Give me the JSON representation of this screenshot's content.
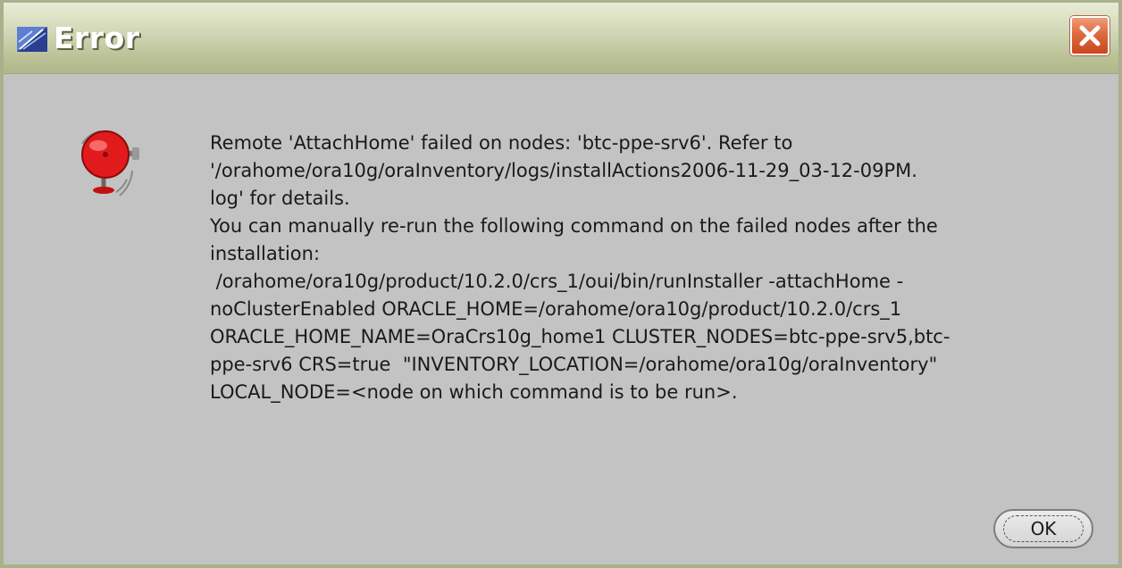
{
  "window": {
    "title": "Error",
    "title_icon": "java-coffee-icon",
    "close_icon": "close-icon"
  },
  "dialog": {
    "icon": "alarm-bell-icon",
    "message": "Remote 'AttachHome' failed on nodes: 'btc-ppe-srv6'. Refer to\n'/orahome/ora10g/oraInventory/logs/installActions2006-11-29_03-12-09PM.\nlog' for details.\nYou can manually re-run the following command on the failed nodes after the\ninstallation:\n /orahome/ora10g/product/10.2.0/crs_1/oui/bin/runInstaller -attachHome -\nnoClusterEnabled ORACLE_HOME=/orahome/ora10g/product/10.2.0/crs_1\nORACLE_HOME_NAME=OraCrs10g_home1 CLUSTER_NODES=btc-ppe-srv5,btc-\nppe-srv6 CRS=true  \"INVENTORY_LOCATION=/orahome/ora10g/oraInventory\"\nLOCAL_NODE=<node on which command is to be run>.",
    "ok_label": "OK"
  },
  "colors": {
    "titlebar": "#c3c9a4",
    "body": "#c3c3c3",
    "close_button": "#d9582b",
    "alarm_red": "#e11b1b"
  }
}
